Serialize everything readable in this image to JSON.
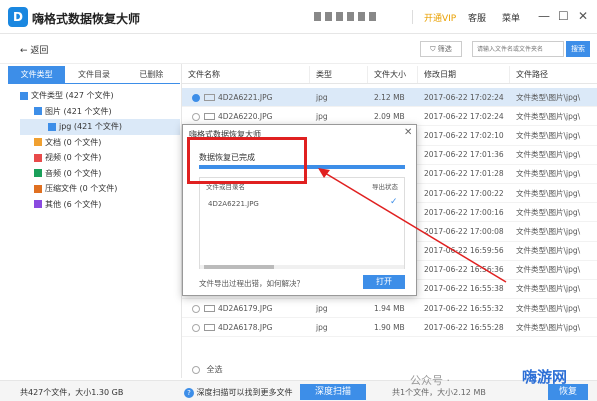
{
  "app": {
    "logo_letter": "D",
    "title": "嗨格式数据恢复大师",
    "vip": "开通VIP",
    "service": "客服",
    "menu": "菜单"
  },
  "toolbar": {
    "back": "返回",
    "filter": "筛选",
    "search_placeholder": "请输入文件名或文件夹名",
    "search_btn": "搜索"
  },
  "left_tabs": [
    {
      "label": "文件类型",
      "active": true
    },
    {
      "label": "文件目录",
      "active": false
    },
    {
      "label": "已删除",
      "active": false
    }
  ],
  "tree": [
    {
      "label": "文件类型 (427 个文件)",
      "indent": 0
    },
    {
      "label": "图片 (421 个文件)",
      "indent": 1
    },
    {
      "label": "jpg (421 个文件)",
      "indent": 2,
      "selected": true
    },
    {
      "label": "文档 (0 个文件)",
      "indent": 1
    },
    {
      "label": "视频 (0 个文件)",
      "indent": 1
    },
    {
      "label": "音频 (0 个文件)",
      "indent": 1
    },
    {
      "label": "压缩文件 (0 个文件)",
      "indent": 1
    },
    {
      "label": "其他 (6 个文件)",
      "indent": 1
    }
  ],
  "columns": [
    "文件名称",
    "类型",
    "文件大小",
    "修改日期",
    "文件路径"
  ],
  "rows": [
    {
      "name": "4D2A6221.JPG",
      "type": "jpg",
      "size": "2.12 MB",
      "date": "2017-06-22 17:02:24",
      "path": "文件类型\\图片\\jpg\\",
      "selected": true
    },
    {
      "name": "4D2A6220.JPG",
      "type": "jpg",
      "size": "2.09 MB",
      "date": "2017-06-22 17:02:24",
      "path": "文件类型\\图片\\jpg\\"
    },
    {
      "name": "",
      "type": "",
      "size": "",
      "date": "2017-06-22 17:02:10",
      "path": "文件类型\\图片\\jpg\\"
    },
    {
      "name": "",
      "type": "",
      "size": "",
      "date": "2017-06-22 17:01:36",
      "path": "文件类型\\图片\\jpg\\"
    },
    {
      "name": "",
      "type": "",
      "size": "",
      "date": "2017-06-22 17:01:28",
      "path": "文件类型\\图片\\jpg\\"
    },
    {
      "name": "",
      "type": "",
      "size": "",
      "date": "2017-06-22 17:00:22",
      "path": "文件类型\\图片\\jpg\\"
    },
    {
      "name": "",
      "type": "",
      "size": "",
      "date": "2017-06-22 17:00:16",
      "path": "文件类型\\图片\\jpg\\"
    },
    {
      "name": "",
      "type": "",
      "size": "",
      "date": "2017-06-22 17:00:08",
      "path": "文件类型\\图片\\jpg\\"
    },
    {
      "name": "",
      "type": "",
      "size": "",
      "date": "2017-06-22 16:59:56",
      "path": "文件类型\\图片\\jpg\\"
    },
    {
      "name": "",
      "type": "",
      "size": "",
      "date": "2017-06-22 16:56:36",
      "path": "文件类型\\图片\\jpg\\"
    },
    {
      "name": "4D2A6180.JPG",
      "type": "jpg",
      "size": "1.93 MB",
      "date": "2017-06-22 16:55:38",
      "path": "文件类型\\图片\\jpg\\"
    },
    {
      "name": "4D2A6179.JPG",
      "type": "jpg",
      "size": "1.94 MB",
      "date": "2017-06-22 16:55:32",
      "path": "文件类型\\图片\\jpg\\"
    },
    {
      "name": "4D2A6178.JPG",
      "type": "jpg",
      "size": "1.90 MB",
      "date": "2017-06-22 16:55:28",
      "path": "文件类型\\图片\\jpg\\"
    }
  ],
  "select_all": "全选",
  "footer": {
    "stats": "共427个文件，大小1.30 GB",
    "tip": "深度扫描可以找到更多文件",
    "deep_scan": "深度扫描",
    "selected": "共1个文件，大小2.12 MB",
    "recover": "恢复"
  },
  "modal": {
    "title": "嗨格式数据恢复大师",
    "status": "数据恢复已完成",
    "progress": 1.0,
    "col_name": "文件或目录名",
    "col_status": "导出状态",
    "item": "4D2A6221.JPG",
    "help": "文件导出过程出错，如何解决？",
    "open_btn": "打开"
  },
  "watermark": {
    "text": "公众号 ·",
    "brand": "嗨游网"
  }
}
